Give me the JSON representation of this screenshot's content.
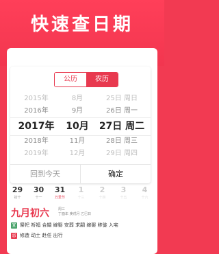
{
  "header": {
    "title": "快速查日期"
  },
  "dialog": {
    "toggle": {
      "solar": "公历",
      "lunar": "农历"
    },
    "years": [
      "2015年",
      "2016年",
      "2017年",
      "2018年",
      "2019年"
    ],
    "months": [
      "8月",
      "9月",
      "10月",
      "11月",
      "12月"
    ],
    "days": [
      "25日 周日",
      "26日 周一",
      "27日 周二",
      "28日 周三",
      "29日 周四"
    ],
    "today_button": "回到今天",
    "confirm_button": "确定"
  },
  "calendar": {
    "week": [
      {
        "day": "29",
        "sub": "初十"
      },
      {
        "day": "30",
        "sub": "十一"
      },
      {
        "day": "31",
        "sub": "万圣节"
      },
      {
        "day": "1",
        "sub": "十三"
      },
      {
        "day": "2",
        "sub": "十四"
      },
      {
        "day": "3",
        "sub": "十五"
      },
      {
        "day": "4",
        "sub": "十六"
      }
    ],
    "lunar_date": "九月初六",
    "meta_line1": "周三",
    "meta_line2": "丁酉年 庚戌月 乙巳日",
    "yi_label": "宜",
    "yi_text": "祭祀 祈福 合婚 嫁娶 安葬 求嗣 嫁娶 移徙 入宅",
    "ji_label": "忌",
    "ji_text": "修造 动土 赴任 出行"
  },
  "colors": {
    "accent": "#e8394f",
    "banner": "#f2364f",
    "good": "#4aa36b"
  }
}
